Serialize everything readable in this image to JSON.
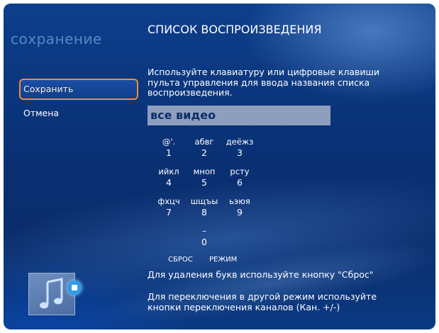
{
  "section_title": "сохранение",
  "page_title": "СПИСОК ВОСПРОИЗВЕДЕНИЯ",
  "menu": {
    "save_label": "Сохранить",
    "cancel_label": "Отмена"
  },
  "instructions": "Используйте клавиатуру или цифровые клавиши пульта управления для ввода названия списка воспроизведения.",
  "name_field": {
    "value": "все видео"
  },
  "keypad": {
    "keys": [
      {
        "letters": "@'.",
        "digit": "1"
      },
      {
        "letters": "абвг",
        "digit": "2"
      },
      {
        "letters": "деёжз",
        "digit": "3"
      },
      {
        "letters": "ийкл",
        "digit": "4"
      },
      {
        "letters": "мноп",
        "digit": "5"
      },
      {
        "letters": "рсту",
        "digit": "6"
      },
      {
        "letters": "фхцч",
        "digit": "7"
      },
      {
        "letters": "шщъы",
        "digit": "8"
      },
      {
        "letters": "ьэюя",
        "digit": "9"
      },
      {
        "letters": "–",
        "digit": "0"
      }
    ],
    "reset_label": "СБРОС",
    "mode_label": "РЕЖИМ"
  },
  "hints": {
    "delete": "Для удаления букв используйте кнопку \"Сброс\"",
    "switch_mode": "Для переключения в другой режим используйте кнопки переключения каналов (Кан. +/-)"
  },
  "colors": {
    "background": "#0a3277",
    "focus_border": "#f08c3a",
    "field_bg": "#8e9fbd"
  }
}
